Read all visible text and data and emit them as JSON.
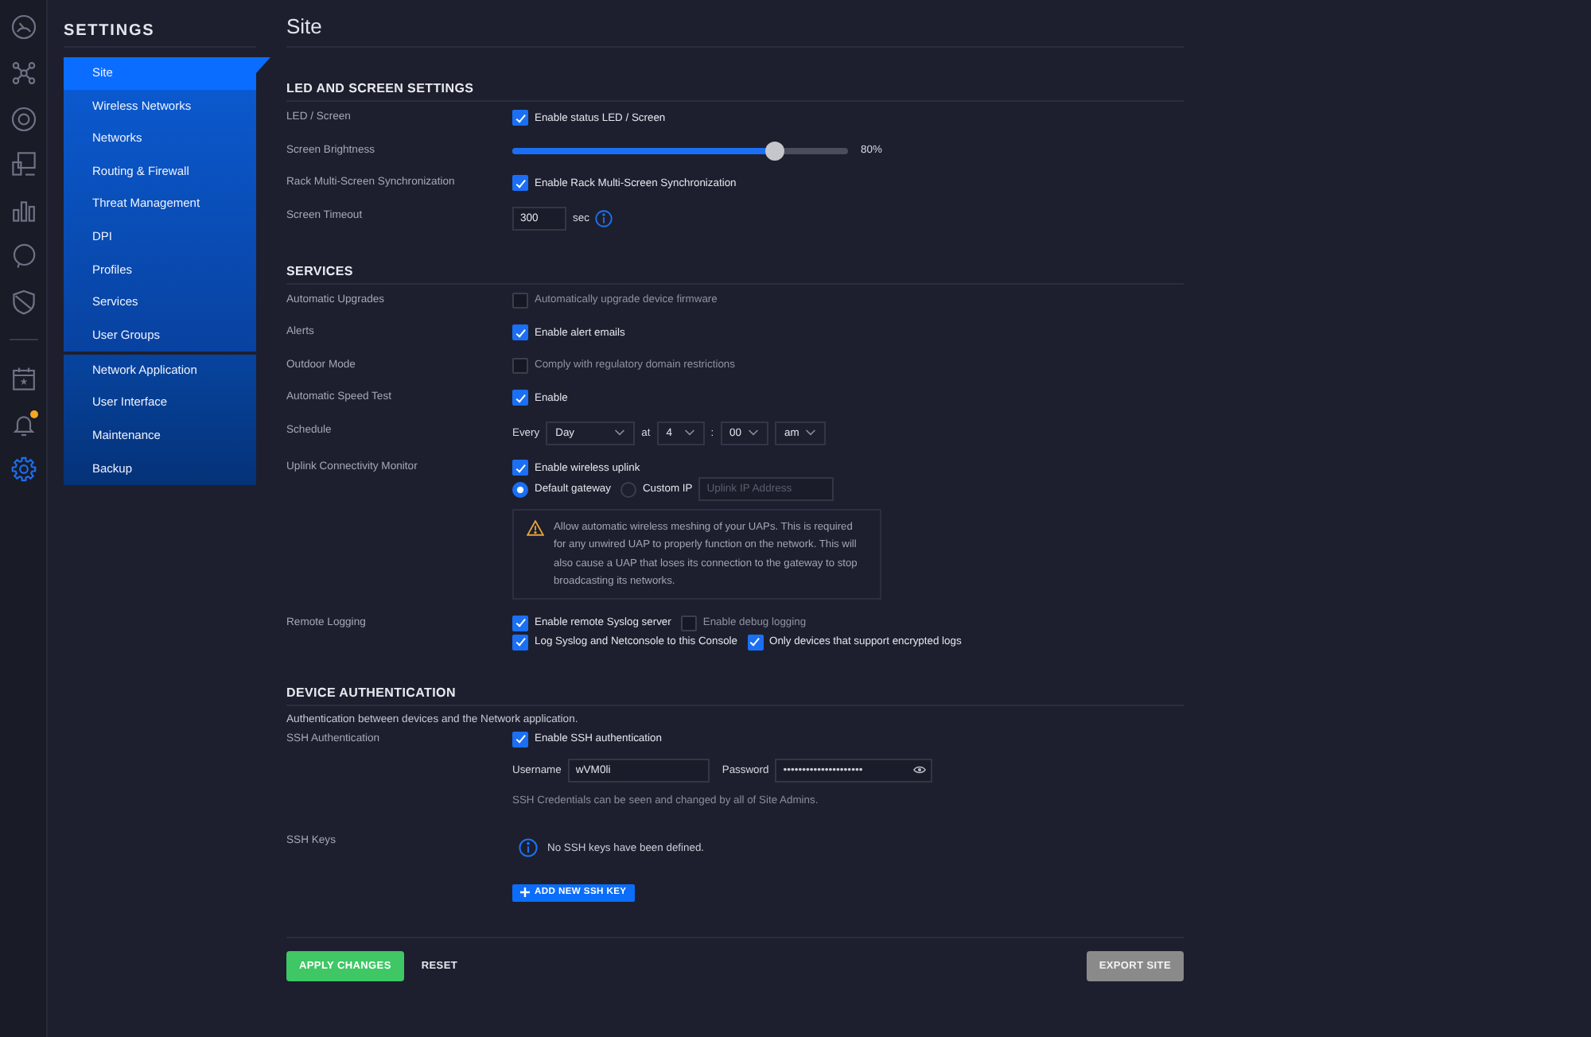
{
  "rail": {
    "groups": [
      {
        "items": [
          {
            "kind": "gauge",
            "selected": false,
            "notification": false
          },
          {
            "kind": "topology",
            "selected": false,
            "notification": false
          },
          {
            "kind": "target",
            "selected": false,
            "notification": false
          },
          {
            "kind": "devices",
            "selected": false,
            "notification": false
          },
          {
            "kind": "stats",
            "selected": false,
            "notification": false
          },
          {
            "kind": "bubble",
            "selected": false,
            "notification": false
          },
          {
            "kind": "shield",
            "selected": false,
            "notification": false
          }
        ]
      },
      {
        "items": [
          {
            "kind": "calendar",
            "selected": false,
            "notification": false
          },
          {
            "kind": "bell",
            "selected": false,
            "notification": true
          },
          {
            "kind": "gear",
            "selected": true,
            "notification": false
          }
        ]
      }
    ]
  },
  "sidebar": {
    "title": "SETTINGS",
    "groups": [
      {
        "items": [
          {
            "label": "Site",
            "selected": true
          },
          {
            "label": "Wireless Networks",
            "selected": false
          },
          {
            "label": "Networks",
            "selected": false
          },
          {
            "label": "Routing & Firewall",
            "selected": false
          },
          {
            "label": "Threat Management",
            "selected": false
          },
          {
            "label": "DPI",
            "selected": false
          },
          {
            "label": "Profiles",
            "selected": false
          },
          {
            "label": "Services",
            "selected": false
          },
          {
            "label": "User Groups",
            "selected": false
          }
        ]
      },
      {
        "items": [
          {
            "label": "Network Application",
            "selected": false
          },
          {
            "label": "User Interface",
            "selected": false
          },
          {
            "label": "Maintenance",
            "selected": false
          },
          {
            "label": "Backup",
            "selected": false
          }
        ]
      }
    ]
  },
  "page": {
    "title": "Site",
    "sections": [
      {
        "heading": "LED AND SCREEN SETTINGS",
        "rows": [
          {
            "label": "LED / Screen",
            "lines": [
              [
                {
                  "kind": "checkbox",
                  "text": "Enable status LED / Screen",
                  "checked": true
                }
              ]
            ]
          },
          {
            "label": "Screen Brightness",
            "lines": [
              [
                {
                  "kind": "slider",
                  "level": 0.8,
                  "reading": "80%"
                }
              ]
            ]
          },
          {
            "label": "Rack Multi-Screen Synchronization",
            "lines": [
              [
                {
                  "kind": "checkbox",
                  "text": "Enable Rack Multi-Screen Synchronization",
                  "checked": true
                }
              ]
            ]
          },
          {
            "label": "Screen Timeout",
            "lines": [
              [
                {
                  "kind": "input",
                  "value": "300"
                },
                {
                  "kind": "text",
                  "text": "sec"
                },
                {
                  "kind": "info"
                }
              ]
            ]
          }
        ]
      },
      {
        "heading": "SERVICES",
        "rows": [
          {
            "label": "Automatic Upgrades",
            "lines": [
              [
                {
                  "kind": "checkbox",
                  "text": "Automatically upgrade device firmware",
                  "checked": false
                }
              ]
            ]
          },
          {
            "label": "Alerts",
            "lines": [
              [
                {
                  "kind": "checkbox",
                  "text": "Enable alert emails",
                  "checked": true
                }
              ]
            ]
          },
          {
            "label": "Outdoor Mode",
            "lines": [
              [
                {
                  "kind": "checkbox",
                  "text": "Comply with regulatory domain restrictions",
                  "checked": false
                }
              ]
            ]
          },
          {
            "label": "Automatic Speed Test",
            "lines": [
              [
                {
                  "kind": "checkbox",
                  "text": "Enable",
                  "checked": true
                }
              ]
            ]
          },
          {
            "label": "Schedule",
            "lines": [
              [
                {
                  "kind": "text",
                  "text": "Every"
                },
                {
                  "kind": "select",
                  "value": "Day"
                },
                {
                  "kind": "text",
                  "text": "at"
                },
                {
                  "kind": "select",
                  "value": "4"
                },
                {
                  "kind": "text",
                  "text": ":"
                },
                {
                  "kind": "select",
                  "value": "00"
                },
                {
                  "kind": "select",
                  "value": "am"
                }
              ]
            ]
          },
          {
            "label": "Uplink Connectivity Monitor",
            "lines": [
              [
                {
                  "kind": "checkbox",
                  "text": "Enable wireless uplink",
                  "checked": true
                }
              ],
              [
                {
                  "kind": "radio",
                  "text": "Default gateway",
                  "selected": true
                },
                {
                  "kind": "radio",
                  "text": "Custom IP",
                  "selected": false
                },
                {
                  "kind": "input",
                  "placeholder": "Uplink IP Address"
                }
              ],
              [
                {
                  "kind": "warning",
                  "text": "Allow automatic wireless meshing of your UAPs. This is required for any unwired UAP to properly function on the network. This will also cause a UAP that loses its connection to the gateway to stop broadcasting its networks."
                }
              ]
            ]
          },
          {
            "label": "Remote Logging",
            "lines": [
              [
                {
                  "kind": "checkbox",
                  "text": "Enable remote Syslog server",
                  "checked": true
                },
                {
                  "kind": "checkbox",
                  "text": "Enable debug logging",
                  "checked": false
                }
              ],
              [
                {
                  "kind": "checkbox",
                  "text": "Log Syslog and Netconsole to this Console",
                  "checked": true
                },
                {
                  "kind": "checkbox",
                  "text": "Only devices that support encrypted logs",
                  "checked": true
                }
              ]
            ]
          }
        ]
      },
      {
        "heading": "DEVICE AUTHENTICATION",
        "description": "Authentication between devices and the Network application.",
        "rows": [
          {
            "label": "SSH Authentication",
            "lines": [
              [
                {
                  "kind": "checkbox",
                  "text": "Enable SSH authentication",
                  "checked": true
                }
              ],
              [
                {
                  "kind": "text",
                  "text": "Username"
                },
                {
                  "kind": "input",
                  "value": "wVM0li"
                },
                {
                  "kind": "text",
                  "text": "Password"
                },
                {
                  "kind": "password",
                  "value": "•••••••••••••••••••••"
                }
              ],
              [
                {
                  "kind": "note",
                  "text": "SSH Credentials can be seen and changed by all of Site Admins."
                }
              ]
            ]
          },
          {
            "label": "SSH Keys",
            "lines": [
              [
                {
                  "kind": "message",
                  "text": "No SSH keys have been defined."
                }
              ],
              [
                {
                  "kind": "button",
                  "text": "ADD NEW SSH KEY"
                }
              ]
            ]
          }
        ]
      }
    ]
  },
  "footer": {
    "buttons": [
      {
        "kind": "apply",
        "text": "APPLY CHANGES"
      },
      {
        "kind": "reset",
        "text": "RESET"
      },
      {
        "kind": "export",
        "text": "EXPORT SITE"
      }
    ]
  }
}
